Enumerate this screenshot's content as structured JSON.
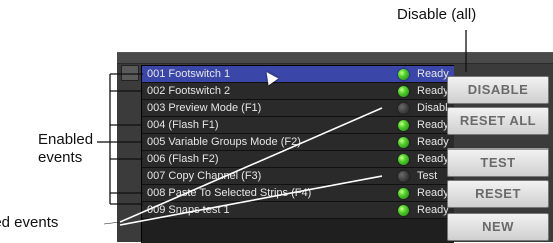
{
  "callouts": {
    "disable_all": "Disable (all)",
    "enabled_events_line1": "Enabled",
    "enabled_events_line2": "events",
    "disabled_events": "led events"
  },
  "events": [
    {
      "label": "001 Footswitch 1",
      "enabled": true,
      "status": "Ready"
    },
    {
      "label": "002 Footswitch 2",
      "enabled": true,
      "status": "Ready"
    },
    {
      "label": "003 Preview Mode (F1)",
      "enabled": false,
      "status": "Disabl"
    },
    {
      "label": "004    (Flash F1)",
      "enabled": true,
      "status": "Ready"
    },
    {
      "label": "005 Variable Groups Mode (F2)",
      "enabled": true,
      "status": "Ready"
    },
    {
      "label": "006    (Flash F2)",
      "enabled": true,
      "status": "Ready"
    },
    {
      "label": "007 Copy Channel (F3)",
      "enabled": false,
      "status": "Test"
    },
    {
      "label": "008 Paste To Selected Strips (F4)",
      "enabled": true,
      "status": "Ready"
    },
    {
      "label": "009 Snaps test 1",
      "enabled": true,
      "status": "Ready"
    }
  ],
  "buttons": {
    "disable": "DISABLE",
    "reset_all": "RESET ALL",
    "test": "TEST",
    "reset": "RESET",
    "new": "NEW"
  }
}
